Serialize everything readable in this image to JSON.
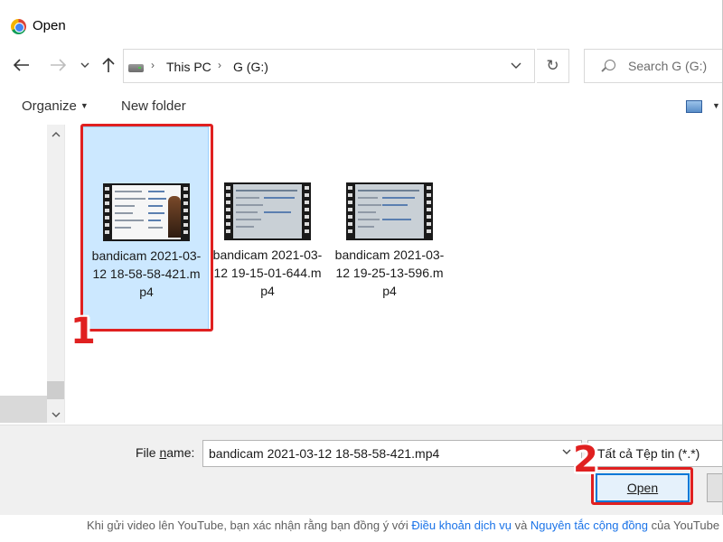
{
  "window": {
    "title": "Open"
  },
  "nav": {
    "breadcrumbs": [
      "This PC",
      "G (G:)"
    ],
    "search_placeholder": "Search G (G:)"
  },
  "toolbar": {
    "organize_label": "Organize",
    "new_folder_label": "New folder"
  },
  "files": [
    {
      "name": "bandicam 2021-03-12 18-58-58-421.mp4",
      "selected": true
    },
    {
      "name": "bandicam 2021-03-12 19-15-01-644.mp4",
      "selected": false
    },
    {
      "name": "bandicam 2021-03-12 19-25-13-596.mp4",
      "selected": false
    }
  ],
  "footer": {
    "filename_label_pre": "File ",
    "filename_label_underlined": "n",
    "filename_label_post": "ame:",
    "filename_value": "bandicam 2021-03-12 18-58-58-421.mp4",
    "file_type": "Tất cả Tệp tin (*.*)",
    "open_label": "Open"
  },
  "annotations": {
    "step1": "1",
    "step2": "2"
  },
  "page_text": {
    "prefix": "Khi gửi video lên YouTube, bạn xác nhận rằng bạn đồng ý với",
    "link1": "Điều khoản dịch vụ",
    "middle": "và",
    "link2": "Nguyên tắc cộng đồng",
    "suffix": "của YouTube"
  },
  "colors": {
    "accent": "#0078d7",
    "selection": "#cce8ff",
    "callout": "#e02020",
    "link": "#1a73e8"
  }
}
